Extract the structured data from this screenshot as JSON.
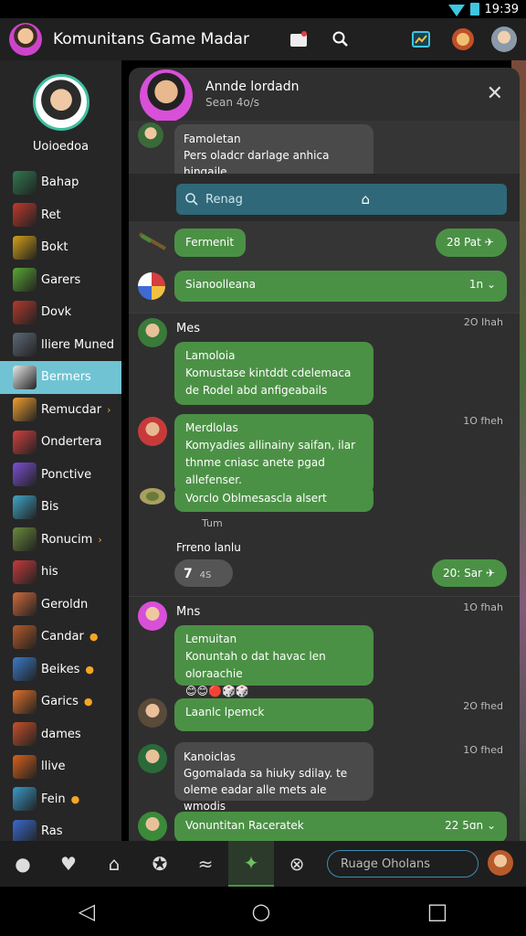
{
  "status": {
    "time": "19:39"
  },
  "app": {
    "title": "Komunitans Game Madar"
  },
  "sidebar": {
    "profile_name": "Uoioedoa",
    "items": [
      {
        "label": "Bahap",
        "color": "#2f7a4f"
      },
      {
        "label": "Ret",
        "color": "#c0392b"
      },
      {
        "label": "Bokt",
        "color": "#d4a017"
      },
      {
        "label": "Garers",
        "color": "#5aa832"
      },
      {
        "label": "Dovk",
        "color": "#b33a2b"
      },
      {
        "label": "lliere Muned",
        "color": "#5e6a78"
      },
      {
        "label": "Bermers",
        "color": "#e8e8e8"
      },
      {
        "label": "Remucdar",
        "color": "#f0a030",
        "badge": "›"
      },
      {
        "label": "Ondertera",
        "color": "#d43f3f"
      },
      {
        "label": "Ponctive",
        "color": "#7b4fd4"
      },
      {
        "label": "Bis",
        "color": "#3fa6c8"
      },
      {
        "label": "Ronucim",
        "color": "#6a8a3a",
        "badge": "›"
      },
      {
        "label": "his",
        "color": "#c83a3a"
      },
      {
        "label": "Geroldn",
        "color": "#d06a3a"
      },
      {
        "label": "Candar",
        "color": "#b85a2a",
        "badge": "●"
      },
      {
        "label": "Beikes",
        "color": "#3a7ac8",
        "badge": "●"
      },
      {
        "label": "Garics",
        "color": "#e0702a",
        "badge": "●"
      },
      {
        "label": "dames",
        "color": "#c8502a"
      },
      {
        "label": "llive",
        "color": "#d8601a"
      },
      {
        "label": "Fein",
        "color": "#3a9ac8",
        "badge": "●"
      },
      {
        "label": "Ras",
        "color": "#3a6ad0"
      }
    ]
  },
  "panel": {
    "head_name": "Annde lordadn",
    "head_sub": "Sean 4o/s",
    "first_bubble_title": "Famoletan",
    "first_bubble_text": "Pers oladcr darlage anhica hingaile",
    "search_placeholder": "Renag",
    "row1_label": "Fermenit",
    "row1_pill": "28 Pat",
    "row2_label": "Sianoolleana",
    "row2_meta": "1n",
    "msg1_sender": "Mes",
    "msg1_time": "2O Ihah",
    "msg1_title": "Lamoloia",
    "msg1_text": "Komustase kintddt cdelemaca de Rodel abd anfigeabails",
    "msg2_time": "1O fheh",
    "msg2_title": "Merdlolas",
    "msg2_text": "Komyadies allinainy saifan, ilar thnme cniasc anete pgad allefenser.",
    "msg3_text": "Vorclo Oblmesascla alsert",
    "msg3_sub": "Tum",
    "group_label": "Frreno lanlu",
    "group_pill": "7",
    "group_pill_sub": "4S",
    "group_right_pill": "20: Sar",
    "msg4_sender": "Mns",
    "msg4_time": "1O fhah",
    "msg4_title": "Lemuitan",
    "msg4_text": "Konuntah o dat havac len oloraachie",
    "msg5_text": "Laanlc lpemck",
    "msg5_time": "2O fhed",
    "msg6_time": "1O fhed",
    "msg6_title": "Kanoiclas",
    "msg6_text": "Ggomalada sa hiuky sdilay. te oleme eadar alle mets ale wmodis",
    "msg7_text": "Vonuntitan Raceratek",
    "msg7_meta": "22 5ɑn"
  },
  "compose": {
    "placeholder": "Ruage Oholans"
  },
  "icons": {
    "search": "search-icon",
    "notifications": "notification-icon",
    "close": "close-icon",
    "home": "home-icon"
  }
}
